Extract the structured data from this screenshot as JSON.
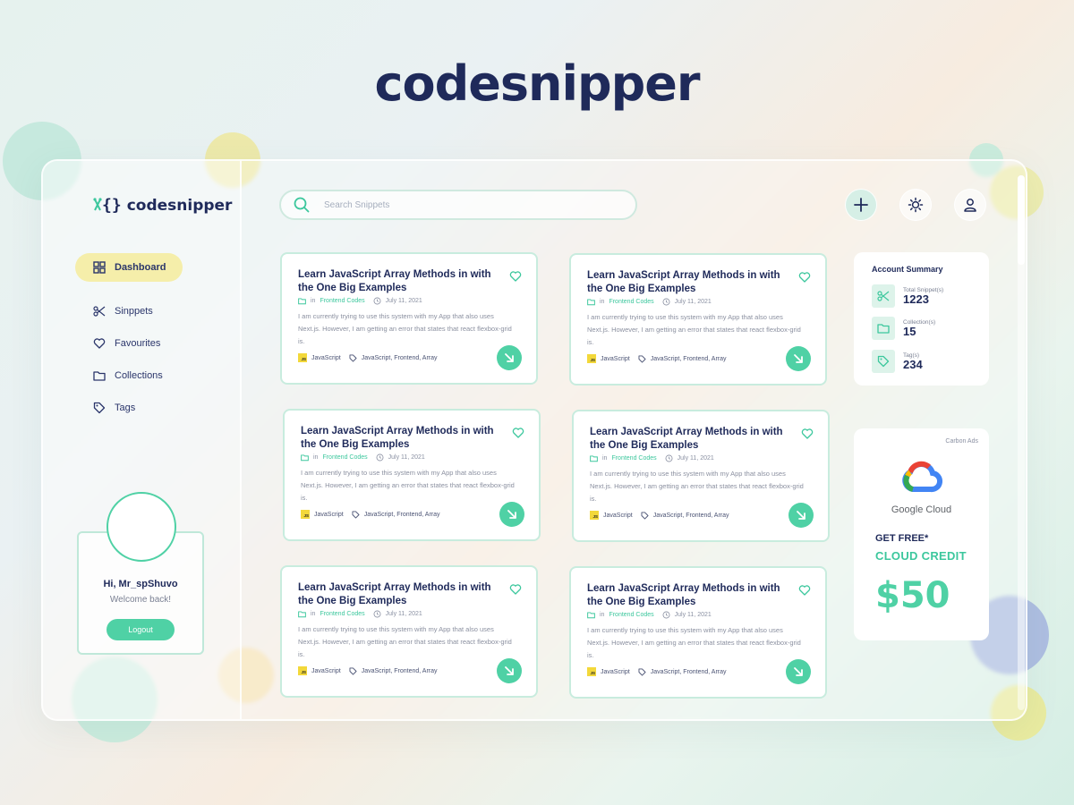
{
  "hero": {
    "title": "codesnipper"
  },
  "brand": {
    "logo_glyph": "{}",
    "name": "codesnipper"
  },
  "nav": {
    "items": [
      {
        "label": "Dashboard",
        "icon": "grid-icon",
        "active": true
      },
      {
        "label": "Sinppets",
        "icon": "scissors-icon",
        "active": false
      },
      {
        "label": "Favourites",
        "icon": "heart-icon",
        "active": false
      },
      {
        "label": "Collections",
        "icon": "folder-icon",
        "active": false
      },
      {
        "label": "Tags",
        "icon": "tag-icon",
        "active": false
      }
    ]
  },
  "profile": {
    "greeting": "Hi, Mr_spShuvo",
    "welcome": "Welcome back!",
    "logout_label": "Logout"
  },
  "search": {
    "placeholder": "Search Snippets"
  },
  "topbar": {
    "icons": [
      "plus-icon",
      "sun-icon",
      "user-icon"
    ]
  },
  "cards": [
    {
      "title": "Learn JavaScript Array Methods in with the One Big Examples",
      "in_label": "in",
      "collection": "Frontend Codes",
      "date": "July 11, 2021",
      "description": "I am currently trying to use this system with my App that also uses Next.js. However, I am getting an error that states that react flexbox-grid is.",
      "language": "JavaScript",
      "tags": "JavaScript, Frontend, Array",
      "badge": "JS"
    },
    {
      "title": "Learn JavaScript Array Methods in with the One Big Examples",
      "in_label": "in",
      "collection": "Frontend Codes",
      "date": "July 11, 2021",
      "description": "I am currently trying to use this system with my App that also uses Next.js. However, I am getting an error that states that react flexbox-grid is.",
      "language": "JavaScript",
      "tags": "JavaScript, Frontend, Array",
      "badge": "JS"
    },
    {
      "title": "Learn JavaScript Array Methods in with the One Big Examples",
      "in_label": "in",
      "collection": "Frontend Codes",
      "date": "July 11, 2021",
      "description": "I am currently trying to use this system with my App that also uses Next.js. However, I am getting an error that states that react flexbox-grid is.",
      "language": "JavaScript",
      "tags": "JavaScript, Frontend, Array",
      "badge": "JS"
    },
    {
      "title": "Learn JavaScript Array Methods in with the One Big Examples",
      "in_label": "in",
      "collection": "Frontend Codes",
      "date": "July 11, 2021",
      "description": "I am currently trying to use this system with my App that also uses Next.js. However, I am getting an error that states that react flexbox-grid is.",
      "language": "JavaScript",
      "tags": "JavaScript, Frontend, Array",
      "badge": "JS"
    },
    {
      "title": "Learn JavaScript Array Methods in with the One Big Examples",
      "in_label": "in",
      "collection": "Frontend Codes",
      "date": "July 11, 2021",
      "description": "I am currently trying to use this system with my App that also uses Next.js. However, I am getting an error that states that react flexbox-grid is.",
      "language": "JavaScript",
      "tags": "JavaScript, Frontend, Array",
      "badge": "JS"
    },
    {
      "title": "Learn JavaScript Array Methods in with the One Big Examples",
      "in_label": "in",
      "collection": "Frontend Codes",
      "date": "July 11, 2021",
      "description": "I am currently trying to use this system with my App that also uses Next.js. However, I am getting an error that states that react flexbox-grid is.",
      "language": "JavaScript",
      "tags": "JavaScript, Frontend, Array",
      "badge": "JS"
    }
  ],
  "summary": {
    "title": "Account Summary",
    "stats": [
      {
        "label": "Total Snippet(s)",
        "value": "1223",
        "icon": "scissors-icon"
      },
      {
        "label": "Collection(s)",
        "value": "15",
        "icon": "folder-icon"
      },
      {
        "label": "Tag(s)",
        "value": "234",
        "icon": "tag-icon"
      }
    ]
  },
  "ad": {
    "label": "Carbon Ads",
    "brand": "Google Cloud",
    "headline": "GET FREE*",
    "subheadline": "CLOUD CREDIT",
    "amount": "$50"
  },
  "colors": {
    "accent": "#4fd1a5",
    "navy": "#1f2a5a",
    "active_nav": "#f5eeaa",
    "js_badge": "#f3d83a"
  }
}
